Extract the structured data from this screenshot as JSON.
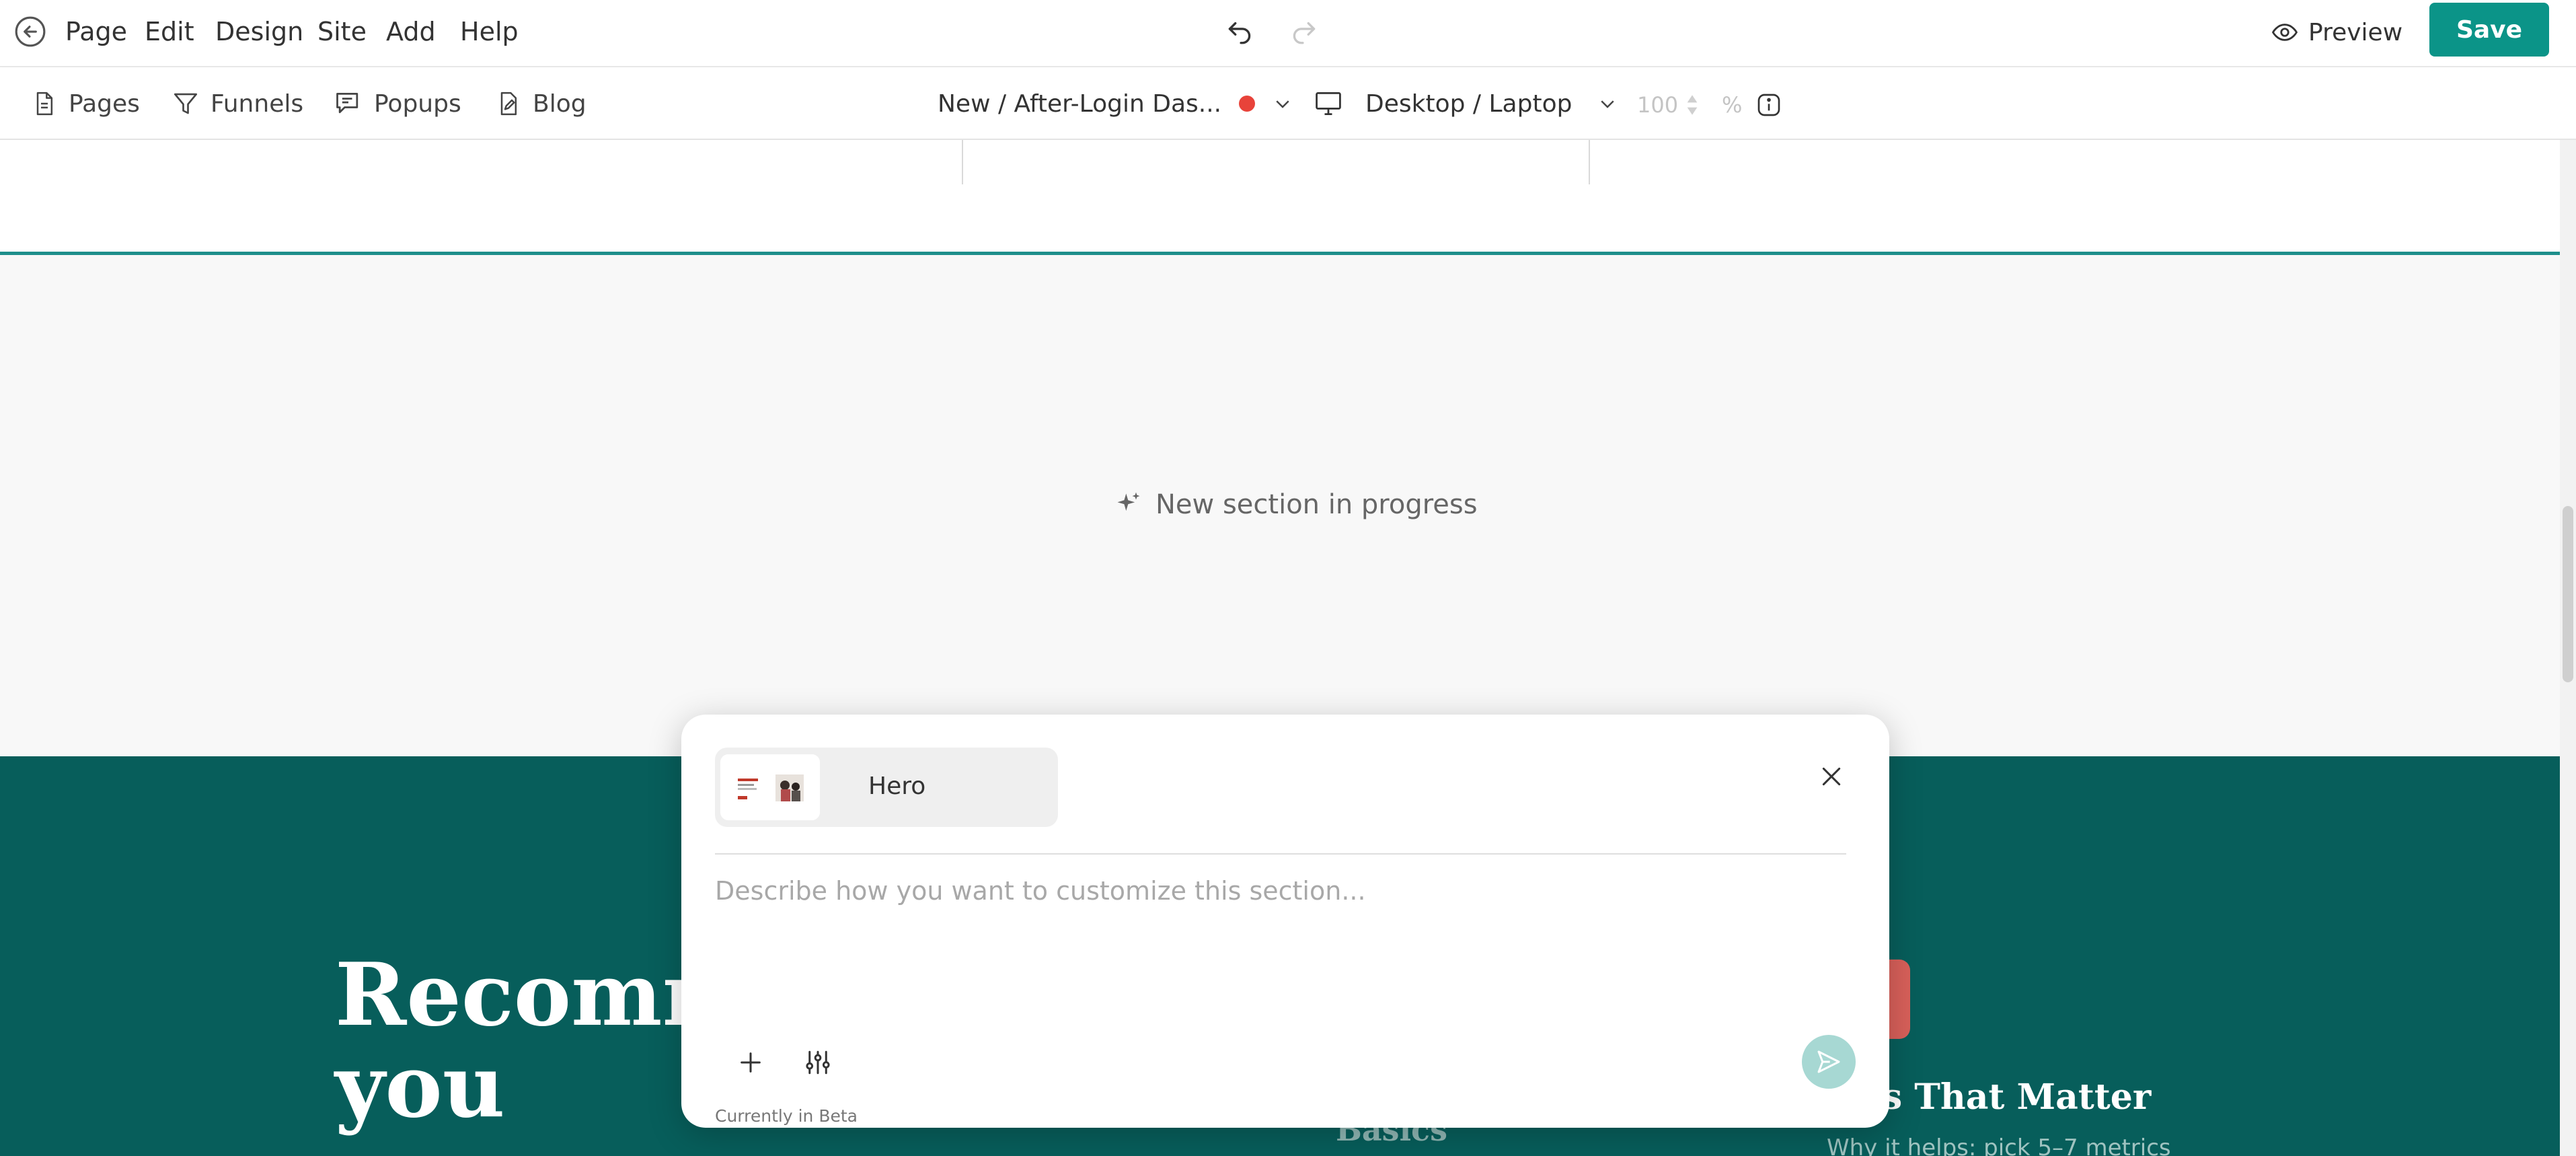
{
  "menu": {
    "items": [
      {
        "label": "Page"
      },
      {
        "label": "Edit"
      },
      {
        "label": "Design"
      },
      {
        "label": "Site"
      },
      {
        "label": "Add"
      },
      {
        "label": "Help"
      }
    ]
  },
  "toolbar": {
    "back_icon": "back-arrow-circle-icon",
    "undo_icon": "undo-icon",
    "redo_icon": "redo-icon",
    "preview_label": "Preview",
    "save_label": "Save",
    "accent_color": "#0b9488"
  },
  "subbar": {
    "tabs": [
      {
        "label": "Pages",
        "icon": "document-icon"
      },
      {
        "label": "Funnels",
        "icon": "funnel-icon"
      },
      {
        "label": "Popups",
        "icon": "popup-icon"
      },
      {
        "label": "Blog",
        "icon": "blog-icon"
      }
    ],
    "current_page": "New / After-Login Das...",
    "unsaved_indicator_color": "#e8433a",
    "device": "Desktop / Laptop",
    "zoom_value": "100",
    "zoom_unit": "%"
  },
  "canvas": {
    "progress_text": "New section in progress",
    "hero": {
      "title_line1": "Recomm",
      "title_line2": "you",
      "card_title_partial": "rics That Matter",
      "card_subtitle_partial": "Basics",
      "card_desc_partial": "Why it helps: pick 5–7 metrics",
      "background_color": "#075e5b"
    }
  },
  "ai_modal": {
    "section_chip_label": "Hero",
    "prompt_placeholder": "Describe how you want to customize this section...",
    "beta_note": "Currently in Beta"
  }
}
